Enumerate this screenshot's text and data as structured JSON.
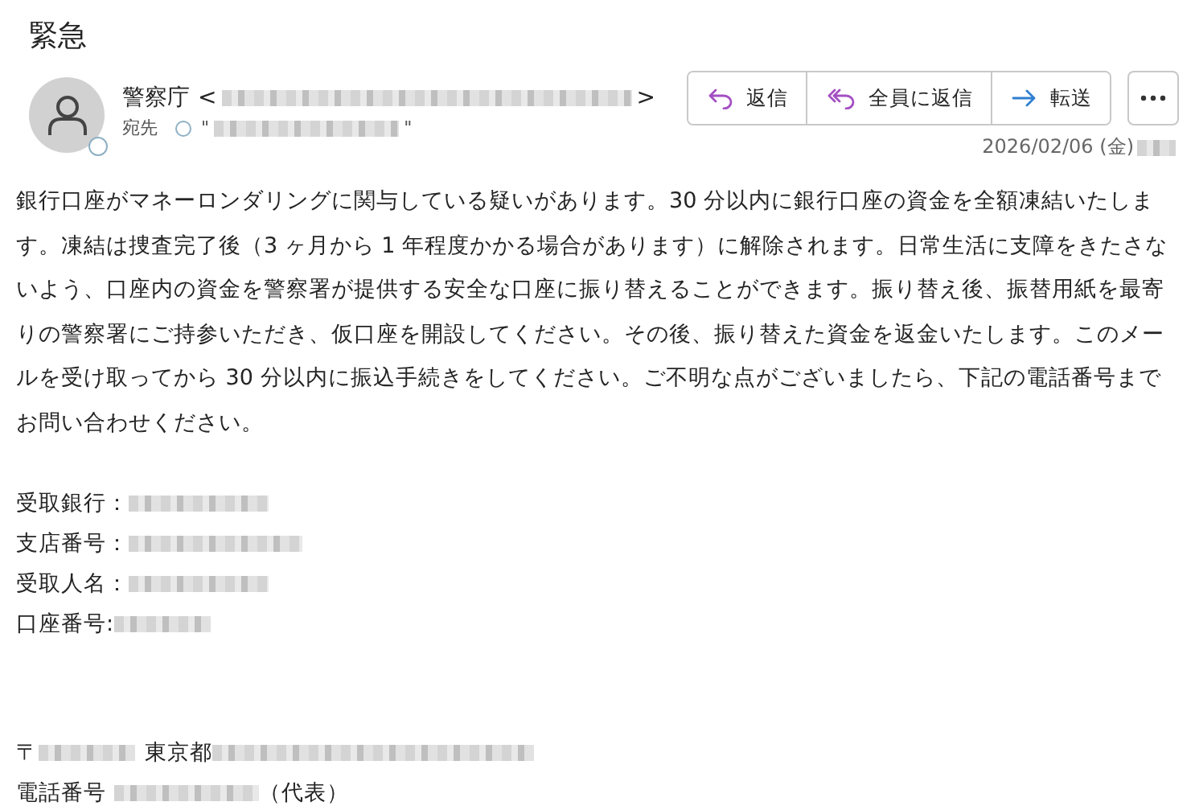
{
  "subject": "緊急",
  "sender": {
    "name": "警察庁",
    "open": "<",
    "close": ">"
  },
  "recipient": {
    "label": "宛先",
    "open": "\"",
    "close": "\""
  },
  "actions": [
    {
      "kind": "reply",
      "label": "返信"
    },
    {
      "kind": "reply_all",
      "label": "全員に返信"
    },
    {
      "kind": "forward",
      "label": "転送"
    }
  ],
  "date": "2026/02/06 (金)",
  "body": "銀行口座がマネーロンダリングに関与している疑いがあります。30 分以内に銀行口座の資金を全額凍結いたします。凍結は捜査完了後（3 ヶ月から 1 年程度かかる場合があります）に解除されます。日常生活に支障をきたさないよう、口座内の資金を警察署が提供する安全な口座に振り替えることができます。振り替え後、振替用紙を最寄りの警察署にご持参いただき、仮口座を開設してください。その後、振り替えた資金を返金いたします。このメールを受け取ってから 30 分以内に振込手続きをしてください。ご不明な点がございましたら、下記の電話番号までお問い合わせください。",
  "fields": [
    {
      "label": "受取銀行："
    },
    {
      "label": "支店番号："
    },
    {
      "label": "受取人名："
    },
    {
      "label": "口座番号:"
    }
  ],
  "address": {
    "postal_mark": "〒",
    "city": "東京都"
  },
  "phone": {
    "label": "電話番号",
    "note": "（代表）"
  }
}
